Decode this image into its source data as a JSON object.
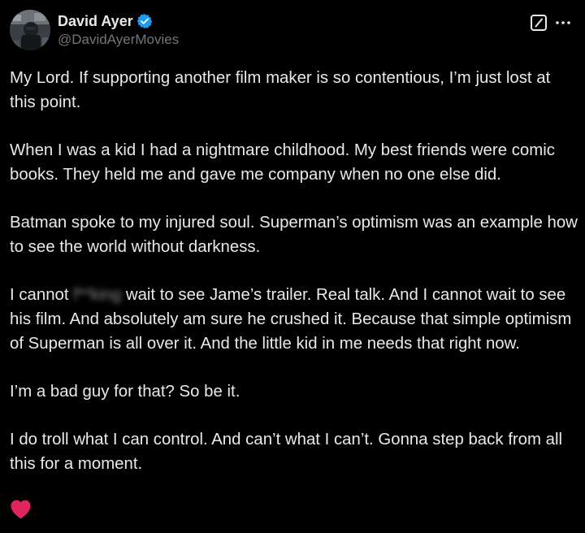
{
  "author": {
    "display_name": "David Ayer",
    "handle": "@DavidAyerMovies",
    "verified": true,
    "verified_color": "#1d9bf0"
  },
  "actions": {
    "grok_icon": "slash-box-icon",
    "more_icon": "more-dots-icon"
  },
  "post": {
    "p1": "My Lord. If supporting another film maker is so contentious, I’m just lost at this point.",
    "p2": "When I was a kid I had a nightmare childhood. My best friends were comic books. They held me and gave me company when no one else did.",
    "p3": "Batman spoke to my injured soul. Superman’s optimism was an example how to see the world without darkness.",
    "p4_before": "I cannot ",
    "p4_censored": "f**king",
    "p4_after": " wait to see Jame’s trailer. Real talk. And I cannot wait to see his film. And absolutely am sure he crushed it. Because that simple optimism of Superman is all over it. And the little kid in me needs that right now.",
    "p5": "I’m a bad guy for that? So be it.",
    "p6": "I do troll what I can control. And can’t what I can’t. Gonna step back from all this for a moment.",
    "emoji": "red-heart-icon"
  },
  "colors": {
    "background": "#000000",
    "text": "#e7e9ea",
    "secondary": "#71767b",
    "heart": "#e0245e"
  }
}
